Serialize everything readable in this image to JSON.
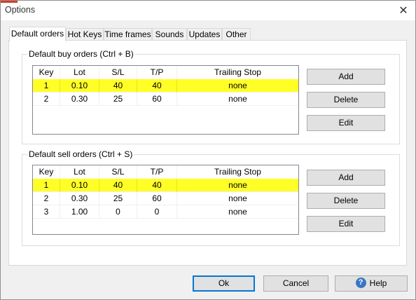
{
  "window": {
    "title": "Options",
    "close_glyph": "✕"
  },
  "tabs": [
    {
      "label": "Default orders",
      "active": true
    },
    {
      "label": "Hot Keys",
      "active": false
    },
    {
      "label": "Time frames",
      "active": false
    },
    {
      "label": "Sounds",
      "active": false
    },
    {
      "label": "Updates",
      "active": false
    },
    {
      "label": "Other",
      "active": false
    }
  ],
  "buy": {
    "title": "Default buy orders (Ctrl + B)",
    "columns": [
      "Key",
      "Lot",
      "S/L",
      "T/P",
      "Trailing Stop"
    ],
    "rows": [
      [
        "1",
        "0.10",
        "40",
        "40",
        "none"
      ],
      [
        "2",
        "0.30",
        "25",
        "60",
        "none"
      ]
    ],
    "selected_row": 0,
    "buttons": {
      "add": "Add",
      "delete": "Delete",
      "edit": "Edit"
    }
  },
  "sell": {
    "title": "Default sell orders (Ctrl + S)",
    "columns": [
      "Key",
      "Lot",
      "S/L",
      "T/P",
      "Trailing Stop"
    ],
    "rows": [
      [
        "1",
        "0.10",
        "40",
        "40",
        "none"
      ],
      [
        "2",
        "0.30",
        "25",
        "60",
        "none"
      ],
      [
        "3",
        "1.00",
        "0",
        "0",
        "none"
      ]
    ],
    "selected_row": 0,
    "buttons": {
      "add": "Add",
      "delete": "Delete",
      "edit": "Edit"
    }
  },
  "footer": {
    "ok": "Ok",
    "cancel": "Cancel",
    "help": "Help",
    "help_icon_glyph": "?"
  },
  "colors": {
    "selection": "#ffff26",
    "accent": "#0078d7"
  }
}
